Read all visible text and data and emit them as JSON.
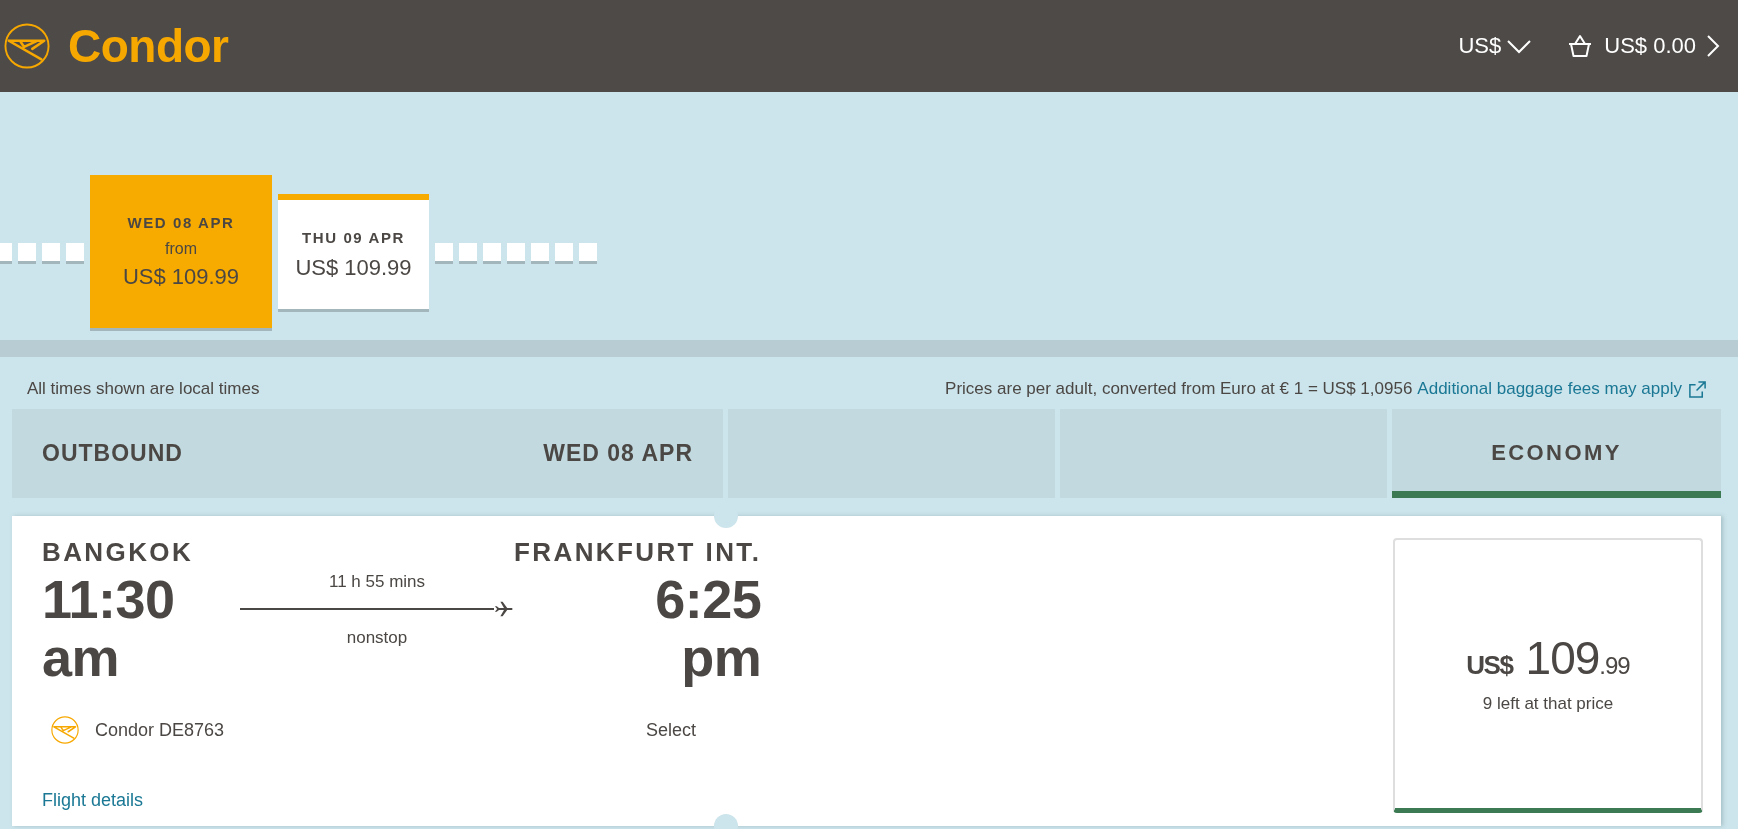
{
  "header": {
    "brand": "Condor",
    "currency": "US$",
    "basket_total": "US$ 0.00"
  },
  "date_strip": [
    {
      "kind": "empty"
    },
    {
      "kind": "empty"
    },
    {
      "kind": "empty"
    },
    {
      "kind": "empty"
    },
    {
      "kind": "day",
      "date": "WED 08 APR",
      "from": "from",
      "price": "US$ 109.99",
      "selected": true
    },
    {
      "kind": "day",
      "date": "THU 09 APR",
      "price": "US$ 109.99",
      "selected": false
    },
    {
      "kind": "empty"
    },
    {
      "kind": "empty"
    },
    {
      "kind": "empty"
    },
    {
      "kind": "empty"
    },
    {
      "kind": "empty"
    },
    {
      "kind": "empty"
    },
    {
      "kind": "empty"
    }
  ],
  "info": {
    "times_note": "All times shown are local times",
    "price_note": "Prices are per adult, converted from Euro at € 1 = US$ 1,0956",
    "baggage_link": "Additional baggage fees may apply"
  },
  "journey_header": {
    "direction": "OUTBOUND",
    "date": "WED 08 APR",
    "cabins": [
      {
        "kind": "blank"
      },
      {
        "kind": "blank"
      },
      {
        "kind": "cabin",
        "label": "ECONOMY",
        "color": "#3b7a52"
      }
    ]
  },
  "flights": [
    {
      "origin": "BANGKOK",
      "departure": "11:30 am",
      "duration": "11 h 55 mins",
      "stops": "nonstop",
      "destination": "FRANKFURT INT.",
      "arrival": "6:25 pm",
      "carrier": "Condor DE8763",
      "select": "Select",
      "details": "Flight details",
      "fares": [
        {
          "kind": "blank"
        },
        {
          "kind": "blank"
        },
        {
          "kind": "fare",
          "currency": "US$",
          "amount": "109",
          "cents": ".99",
          "availability": "9 left at that price"
        }
      ]
    }
  ]
}
